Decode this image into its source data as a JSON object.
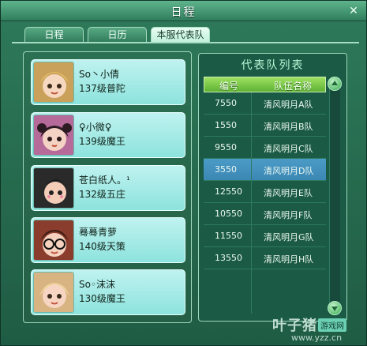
{
  "window": {
    "title": "日程",
    "close_glyph": "✕"
  },
  "tabs": [
    {
      "label": "日程",
      "active": false
    },
    {
      "label": "日历",
      "active": false
    },
    {
      "label": "本服代表队",
      "active": true
    }
  ],
  "members": [
    {
      "name": "So丶小倩",
      "info": "137级普陀",
      "avatar": "avatar-blonde"
    },
    {
      "name": "♀小微♀",
      "info": "139级魔王",
      "avatar": "avatar-dark-pigtails"
    },
    {
      "name": "苍白纸人。¹",
      "info": "132级五庄",
      "avatar": "avatar-black-hair"
    },
    {
      "name": "蓦蓦青萝",
      "info": "140级天策",
      "avatar": "avatar-glasses"
    },
    {
      "name": "So◦沫沫",
      "info": "130级魔王",
      "avatar": "avatar-light-hair"
    }
  ],
  "team_list": {
    "title": "代表队列表",
    "columns": [
      "编号",
      "队伍名称"
    ],
    "rows": [
      {
        "id": "7550",
        "name": "清风明月A队",
        "selected": false
      },
      {
        "id": "1550",
        "name": "清风明月B队",
        "selected": false
      },
      {
        "id": "9550",
        "name": "清风明月C队",
        "selected": false
      },
      {
        "id": "3550",
        "name": "清风明月D队",
        "selected": true
      },
      {
        "id": "12550",
        "name": "清风明月E队",
        "selected": false
      },
      {
        "id": "10550",
        "name": "清风明月F队",
        "selected": false
      },
      {
        "id": "11550",
        "name": "清风明月G队",
        "selected": false
      },
      {
        "id": "13550",
        "name": "清风明月H队",
        "selected": false
      }
    ]
  },
  "watermark": {
    "brand": "叶子猪",
    "badge": "游戏网",
    "url": "www.yzz.cn"
  },
  "colors": {
    "accent": "#5eb233",
    "selected_row": "#3c87b4",
    "card_bg": "#9de6e1"
  }
}
